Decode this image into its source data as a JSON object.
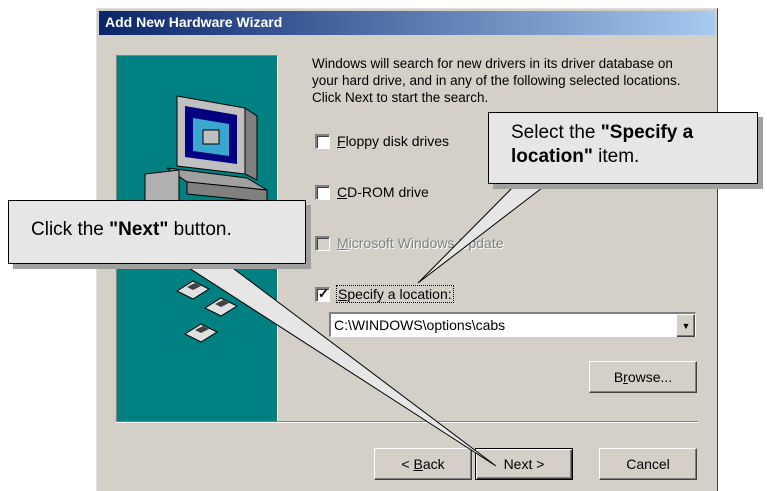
{
  "window": {
    "title": "Add New Hardware Wizard"
  },
  "intro_text": "Windows will search for new drivers in its driver database on your hard drive, and in any of the following selected locations. Click Next to start the search.",
  "options": [
    {
      "label": "Floppy disk drives",
      "accel": "F",
      "rest": "loppy disk drives",
      "checked": false,
      "enabled": true
    },
    {
      "label": "CD-ROM drive",
      "accel": "C",
      "rest": "D-ROM drive",
      "checked": false,
      "enabled": true
    },
    {
      "label": "Microsoft Windows Update",
      "accel": "M",
      "rest": "icrosoft Windows Update",
      "checked": false,
      "enabled": false
    },
    {
      "label": "Specify a location:",
      "accel": "S",
      "rest": "pecify a location:",
      "checked": true,
      "enabled": true
    }
  ],
  "location": {
    "value": "C:\\WINDOWS\\options\\cabs",
    "arrow": "▼"
  },
  "buttons": {
    "browse": {
      "pre": "B",
      "accel": "r",
      "post": "owse..."
    },
    "back": {
      "pre": "< ",
      "accel": "B",
      "post": "ack"
    },
    "next": "Next >",
    "cancel": "Cancel"
  },
  "callouts": {
    "specify": {
      "pre": "Select the ",
      "bold": "\"Specify a location\"",
      "post": " item."
    },
    "next": {
      "pre": "Click the ",
      "bold": "\"Next\"",
      "post": " button."
    }
  },
  "colors": {
    "titlebar_start": "#0a246a",
    "titlebar_end": "#a6caf0",
    "banner": "#008080",
    "dialog_face": "#d4d0c8",
    "callout_fill": "#e6e6e6"
  }
}
